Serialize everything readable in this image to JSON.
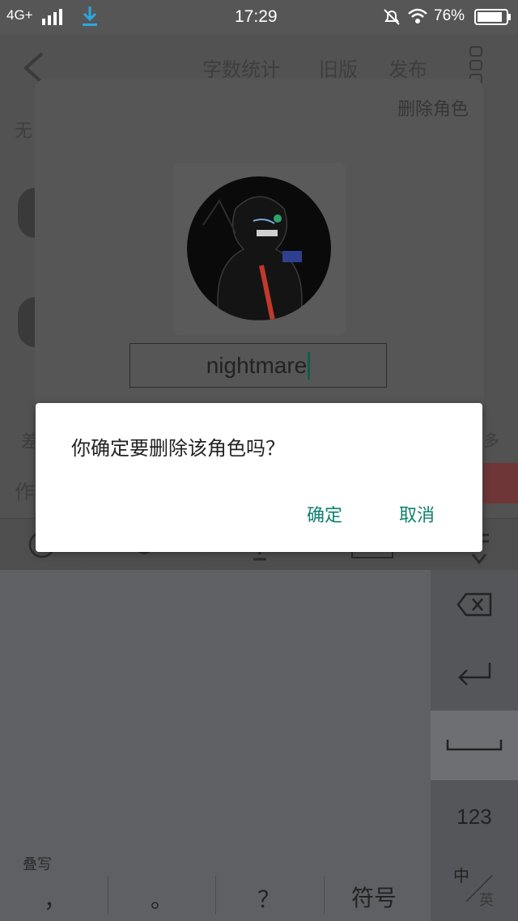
{
  "status_bar": {
    "network": "4G+",
    "time": "17:29",
    "battery": "76%"
  },
  "editor": {
    "header_items": [
      "字数统计",
      "旧版",
      "发布"
    ],
    "row_chars": [
      "无",
      "差",
      "作",
      "多"
    ]
  },
  "role_panel": {
    "delete_role": "删除角色",
    "name_value": "nightmare"
  },
  "dialog": {
    "message": "你确定要删除该角色吗？",
    "confirm": "确定",
    "cancel": "取消"
  },
  "keyboard": {
    "handwrite_label": "叠写",
    "bottom_keys": [
      "，",
      "。",
      "？",
      "符号"
    ],
    "num_key": "123",
    "lang_top": "中",
    "lang_bottom": "英"
  },
  "colors": {
    "accent": "#0f7f6f",
    "overlay": "#5d5d5d"
  }
}
